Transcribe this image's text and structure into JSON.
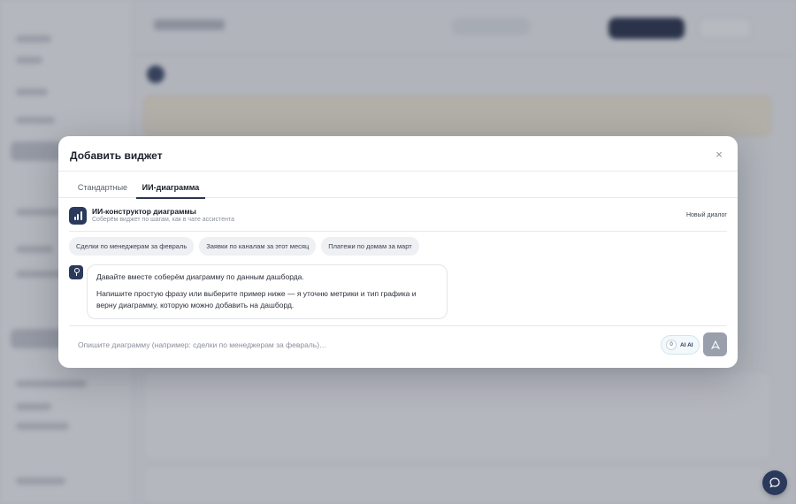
{
  "modal": {
    "title": "Добавить виджет",
    "close_symbol": "×"
  },
  "tabs": [
    {
      "label": "Стандартные",
      "active": false
    },
    {
      "label": "ИИ-диаграмма",
      "active": true
    }
  ],
  "ai_builder": {
    "name": "ИИ-конструктор диаграммы",
    "subtitle": "Соберём виджет по шагам, как в чате ассистента",
    "new_dialog": "Новый диалог",
    "icon": "bar-chart-icon"
  },
  "suggestions": [
    "Сделки по менеджерам за февраль",
    "Заявки по каналам за этот месяц",
    "Платежи по домам за март"
  ],
  "message": {
    "line1": "Давайте вместе соберём диаграмму по данным дашборда.",
    "line2": "Напишите простую фразу или выберите пример ниже — я уточню метрики и тип графика и верну диаграмму, которую можно добавить на дашборд."
  },
  "composer": {
    "placeholder": "Опишите диаграмму (например: сделки по менеджерам за февраль)…",
    "toggle_count": "0",
    "toggle_label": "AI AI"
  },
  "colors": {
    "accent": "#2b3a5c",
    "send_disabled": "#9aa0ab"
  }
}
